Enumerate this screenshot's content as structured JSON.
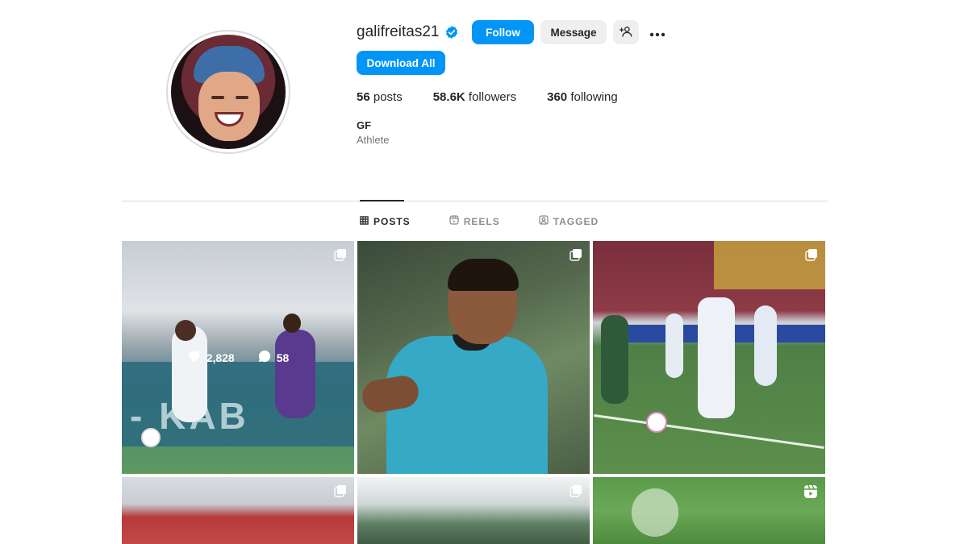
{
  "profile": {
    "username": "galifreitas21",
    "verified": true,
    "name": "GF",
    "category": "Athlete"
  },
  "actions": {
    "follow": "Follow",
    "message": "Message",
    "download_all": "Download All"
  },
  "stats": {
    "posts_count": "56",
    "posts_label": "posts",
    "followers_count": "58.6K",
    "followers_label": "followers",
    "following_count": "360",
    "following_label": "following"
  },
  "tabs": [
    {
      "label": "POSTS",
      "icon": "grid-icon",
      "active": true
    },
    {
      "label": "REELS",
      "icon": "reels-icon",
      "active": false
    },
    {
      "label": "TAGGED",
      "icon": "tagged-icon",
      "active": false
    }
  ],
  "posts": [
    {
      "type": "carousel",
      "hover": true,
      "likes": "2,828",
      "comments": "58"
    },
    {
      "type": "carousel"
    },
    {
      "type": "carousel"
    },
    {
      "type": "carousel"
    },
    {
      "type": "carousel"
    },
    {
      "type": "reel"
    }
  ],
  "colors": {
    "accent": "#0095f6",
    "secondary_button": "#efefef",
    "text": "#262626",
    "muted": "#737373"
  }
}
